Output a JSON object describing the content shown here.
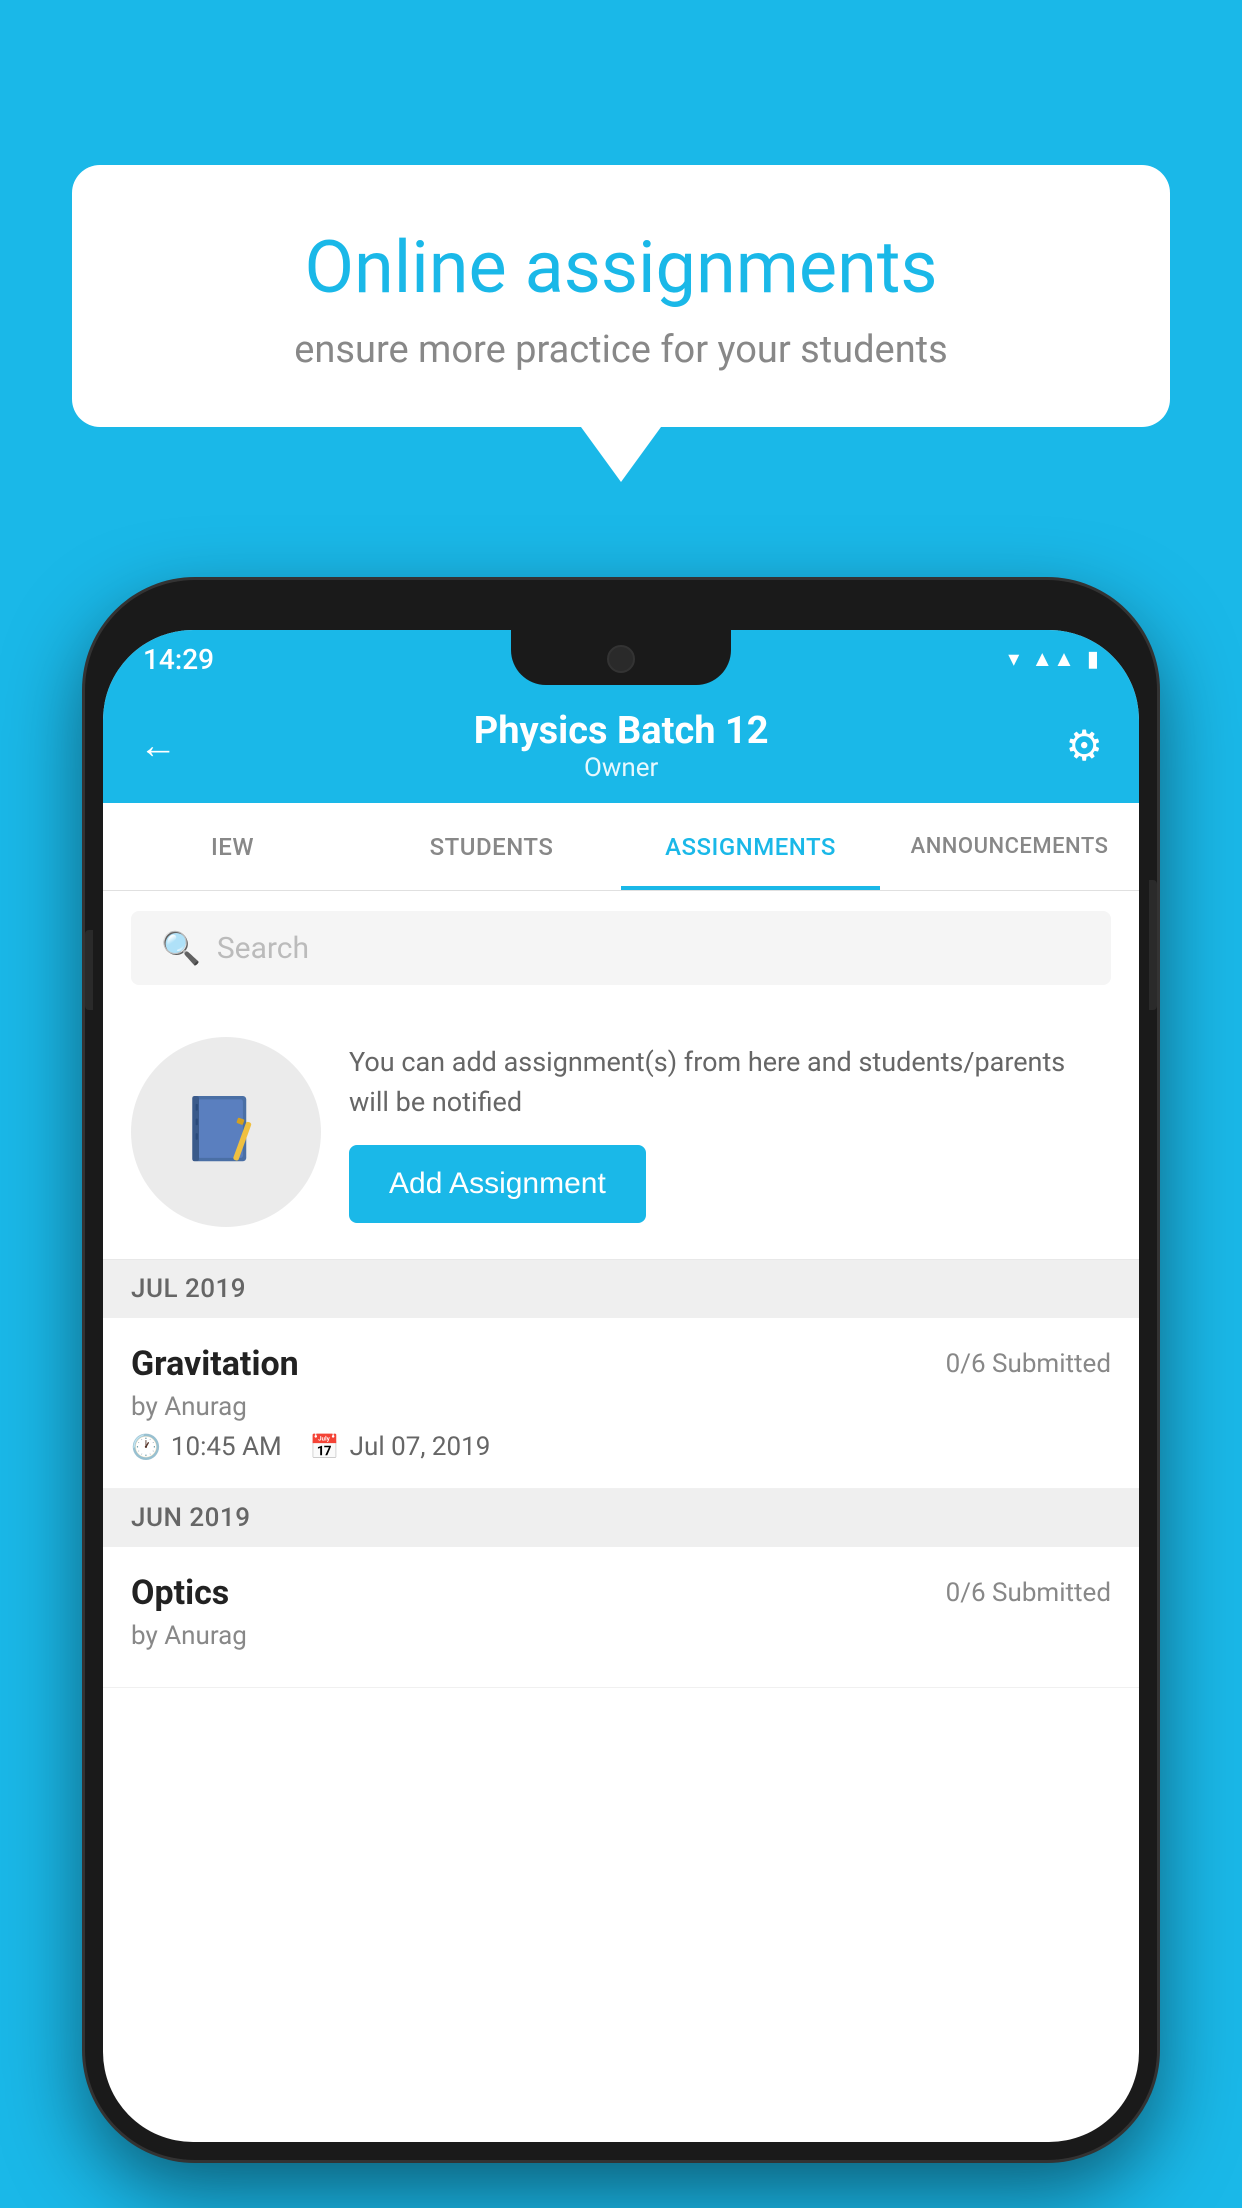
{
  "background_color": "#1ab8e8",
  "speech_bubble": {
    "title": "Online assignments",
    "subtitle": "ensure more practice for your students"
  },
  "phone": {
    "status_bar": {
      "time": "14:29",
      "icons": [
        "wifi",
        "signal",
        "battery"
      ]
    },
    "header": {
      "title": "Physics Batch 12",
      "subtitle": "Owner",
      "back_label": "←",
      "gear_label": "⚙"
    },
    "tabs": [
      {
        "label": "IEW",
        "active": false
      },
      {
        "label": "STUDENTS",
        "active": false
      },
      {
        "label": "ASSIGNMENTS",
        "active": true
      },
      {
        "label": "ANNOUNCEMENTS",
        "active": false
      }
    ],
    "search": {
      "placeholder": "Search"
    },
    "promo": {
      "text": "You can add assignment(s) from here and students/parents will be notified",
      "button_label": "Add Assignment"
    },
    "months": [
      {
        "label": "JUL 2019",
        "assignments": [
          {
            "name": "Gravitation",
            "submitted": "0/6 Submitted",
            "by": "by Anurag",
            "time": "10:45 AM",
            "date": "Jul 07, 2019"
          }
        ]
      },
      {
        "label": "JUN 2019",
        "assignments": [
          {
            "name": "Optics",
            "submitted": "0/6 Submitted",
            "by": "by Anurag",
            "time": "",
            "date": ""
          }
        ]
      }
    ]
  }
}
